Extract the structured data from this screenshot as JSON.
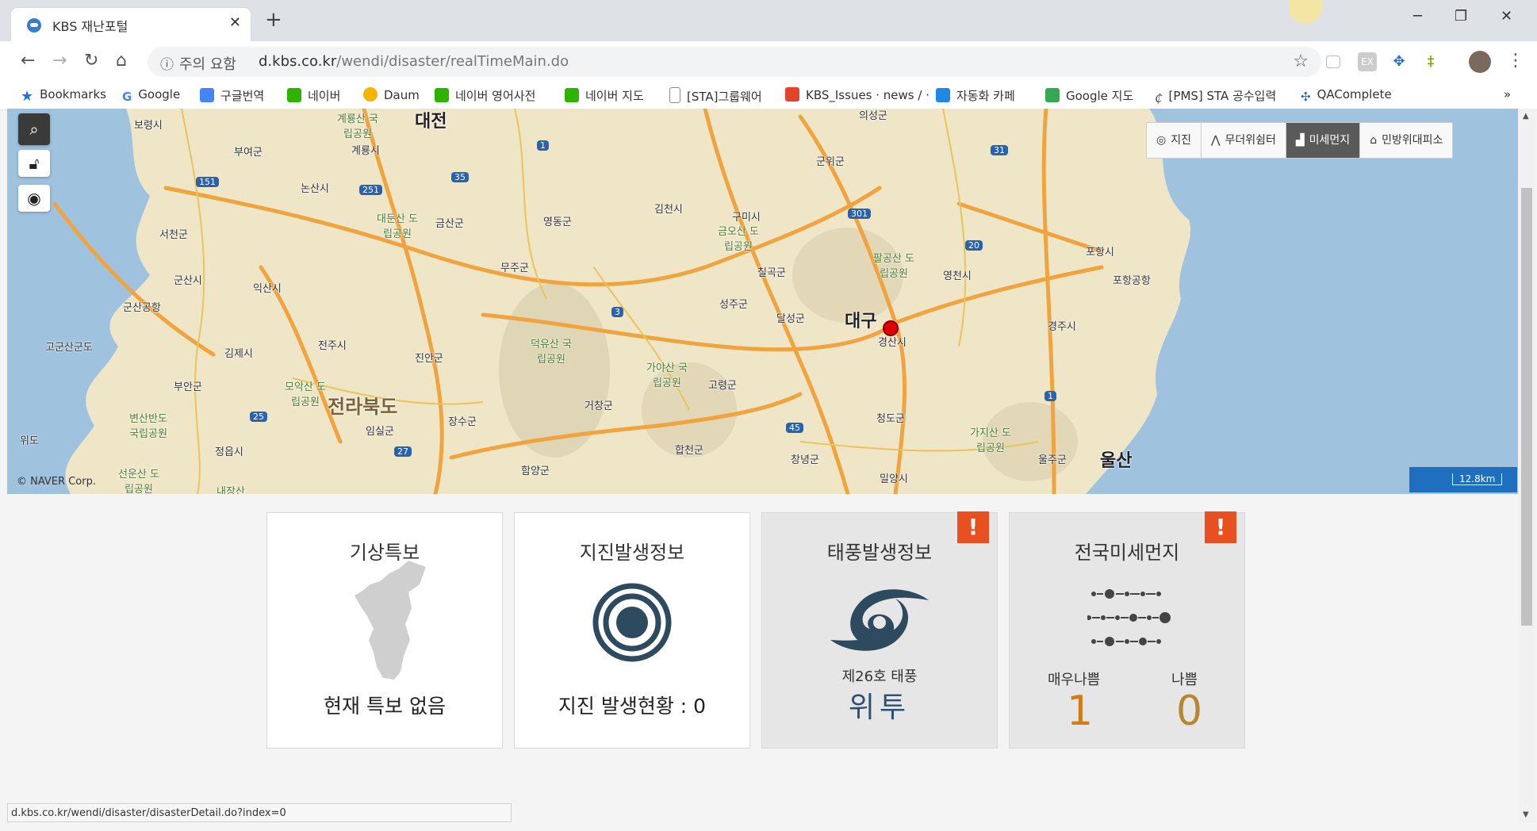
{
  "browser": {
    "tab_title": "KBS 재난포털",
    "new_tab": "+",
    "minimize": "─",
    "restore": "❐",
    "close": "✕",
    "tab_close": "✕",
    "security_label": "주의 요함",
    "url_host": "d.kbs.co.kr",
    "url_path": "/wendi/disaster/realTimeMain.do",
    "status_url": "d.kbs.co.kr/wendi/disaster/disasterDetail.do?index=0"
  },
  "bookmarks": [
    {
      "label": "Bookmarks",
      "color": "#1a73e8"
    },
    {
      "label": "Google",
      "color": "#4285f4"
    },
    {
      "label": "구글번역",
      "color": "#4285f4"
    },
    {
      "label": "네이버",
      "color": "#2db400"
    },
    {
      "label": "Daum",
      "color": "#f4b400"
    },
    {
      "label": "네이버 영어사전",
      "color": "#2db400"
    },
    {
      "label": "네이버 지도",
      "color": "#2db400"
    },
    {
      "label": "[STA]그룹웨어",
      "color": "#888888"
    },
    {
      "label": "KBS_Issues · news / ·",
      "color": "#e24329"
    },
    {
      "label": "자동화 카페",
      "color": "#1e88e5"
    },
    {
      "label": "Google 지도",
      "color": "#34a853"
    },
    {
      "label": "[PMS] STA 공수입력",
      "color": "#555555"
    },
    {
      "label": "QAComplete",
      "color": "#2a6ebb"
    }
  ],
  "bookmarks_more": "»",
  "map": {
    "layers": [
      {
        "label": "지진",
        "icon": "target-icon",
        "active": false
      },
      {
        "label": "무더위쉼터",
        "icon": "tent-icon",
        "active": false
      },
      {
        "label": "미세먼지",
        "icon": "factory-icon",
        "active": true
      },
      {
        "label": "민방위대피소",
        "icon": "house-icon",
        "active": false
      }
    ],
    "copyright": "© NAVER Corp.",
    "scale": "12.8km",
    "places": [
      {
        "label": "대전",
        "cls": "big"
      },
      {
        "label": "대구",
        "cls": "big"
      },
      {
        "label": "울산",
        "cls": "big"
      },
      {
        "label": "전라북도",
        "cls": "prov"
      },
      {
        "label": "보령시",
        "cls": ""
      },
      {
        "label": "계룡산 국립공원",
        "cls": "park"
      },
      {
        "label": "계룡시",
        "cls": ""
      },
      {
        "label": "부여군",
        "cls": ""
      },
      {
        "label": "논산시",
        "cls": ""
      },
      {
        "label": "서천군",
        "cls": ""
      },
      {
        "label": "대둔산 도립공원",
        "cls": "park"
      },
      {
        "label": "금산군",
        "cls": ""
      },
      {
        "label": "영동군",
        "cls": ""
      },
      {
        "label": "김천시",
        "cls": ""
      },
      {
        "label": "구미시",
        "cls": ""
      },
      {
        "label": "금오산 도립공원",
        "cls": "park"
      },
      {
        "label": "군위군",
        "cls": ""
      },
      {
        "label": "의성군",
        "cls": ""
      },
      {
        "label": "팔공산 도립공원",
        "cls": "park"
      },
      {
        "label": "영천시",
        "cls": ""
      },
      {
        "label": "포항시",
        "cls": ""
      },
      {
        "label": "포항공항",
        "cls": ""
      },
      {
        "label": "경주시",
        "cls": ""
      },
      {
        "label": "군산시",
        "cls": ""
      },
      {
        "label": "군산공항",
        "cls": ""
      },
      {
        "label": "익산시",
        "cls": ""
      },
      {
        "label": "무주군",
        "cls": ""
      },
      {
        "label": "칠곡군",
        "cls": ""
      },
      {
        "label": "성주군",
        "cls": ""
      },
      {
        "label": "달성군",
        "cls": ""
      },
      {
        "label": "경산시",
        "cls": ""
      },
      {
        "label": "고군산군도",
        "cls": ""
      },
      {
        "label": "김제시",
        "cls": ""
      },
      {
        "label": "전주시",
        "cls": ""
      },
      {
        "label": "진안군",
        "cls": ""
      },
      {
        "label": "덕유산 국립공원",
        "cls": "park"
      },
      {
        "label": "가야산 국립공원",
        "cls": "park"
      },
      {
        "label": "고령군",
        "cls": ""
      },
      {
        "label": "부안군",
        "cls": ""
      },
      {
        "label": "모악산 도립공원",
        "cls": "park"
      },
      {
        "label": "거창군",
        "cls": ""
      },
      {
        "label": "장수군",
        "cls": ""
      },
      {
        "label": "청도군",
        "cls": ""
      },
      {
        "label": "가지산 도립공원",
        "cls": "park"
      },
      {
        "label": "위도",
        "cls": ""
      },
      {
        "label": "변산반도 국립공원",
        "cls": "park"
      },
      {
        "label": "임실군",
        "cls": ""
      },
      {
        "label": "정읍시",
        "cls": ""
      },
      {
        "label": "합천군",
        "cls": ""
      },
      {
        "label": "창녕군",
        "cls": ""
      },
      {
        "label": "울주군",
        "cls": ""
      },
      {
        "label": "선운산 도립공원",
        "cls": "park"
      },
      {
        "label": "내장산",
        "cls": "park"
      },
      {
        "label": "함양군",
        "cls": ""
      },
      {
        "label": "밀양시",
        "cls": ""
      }
    ],
    "route_shields": [
      "151",
      "251",
      "35",
      "1",
      "31",
      "301",
      "20",
      "3",
      "25",
      "27",
      "45",
      "1"
    ]
  },
  "cards": {
    "weather": {
      "title": "기상특보",
      "body": "현재 특보 없음"
    },
    "earthquake": {
      "title": "지진발생정보",
      "body": "지진 발생현황 : 0"
    },
    "typhoon": {
      "title": "태풍발생정보",
      "alert": "!",
      "subtitle": "제26호 태풍",
      "name": "위투"
    },
    "dust": {
      "title": "전국미세먼지",
      "alert": "!",
      "very_bad_label": "매우나쁨",
      "very_bad_value": "1",
      "bad_label": "나쁨",
      "bad_value": "0"
    }
  },
  "colors": {
    "alert": "#e8511f",
    "typhoon_name": "#2e5070",
    "dust_value": "#d17c18",
    "map_marker": "#e00000"
  }
}
